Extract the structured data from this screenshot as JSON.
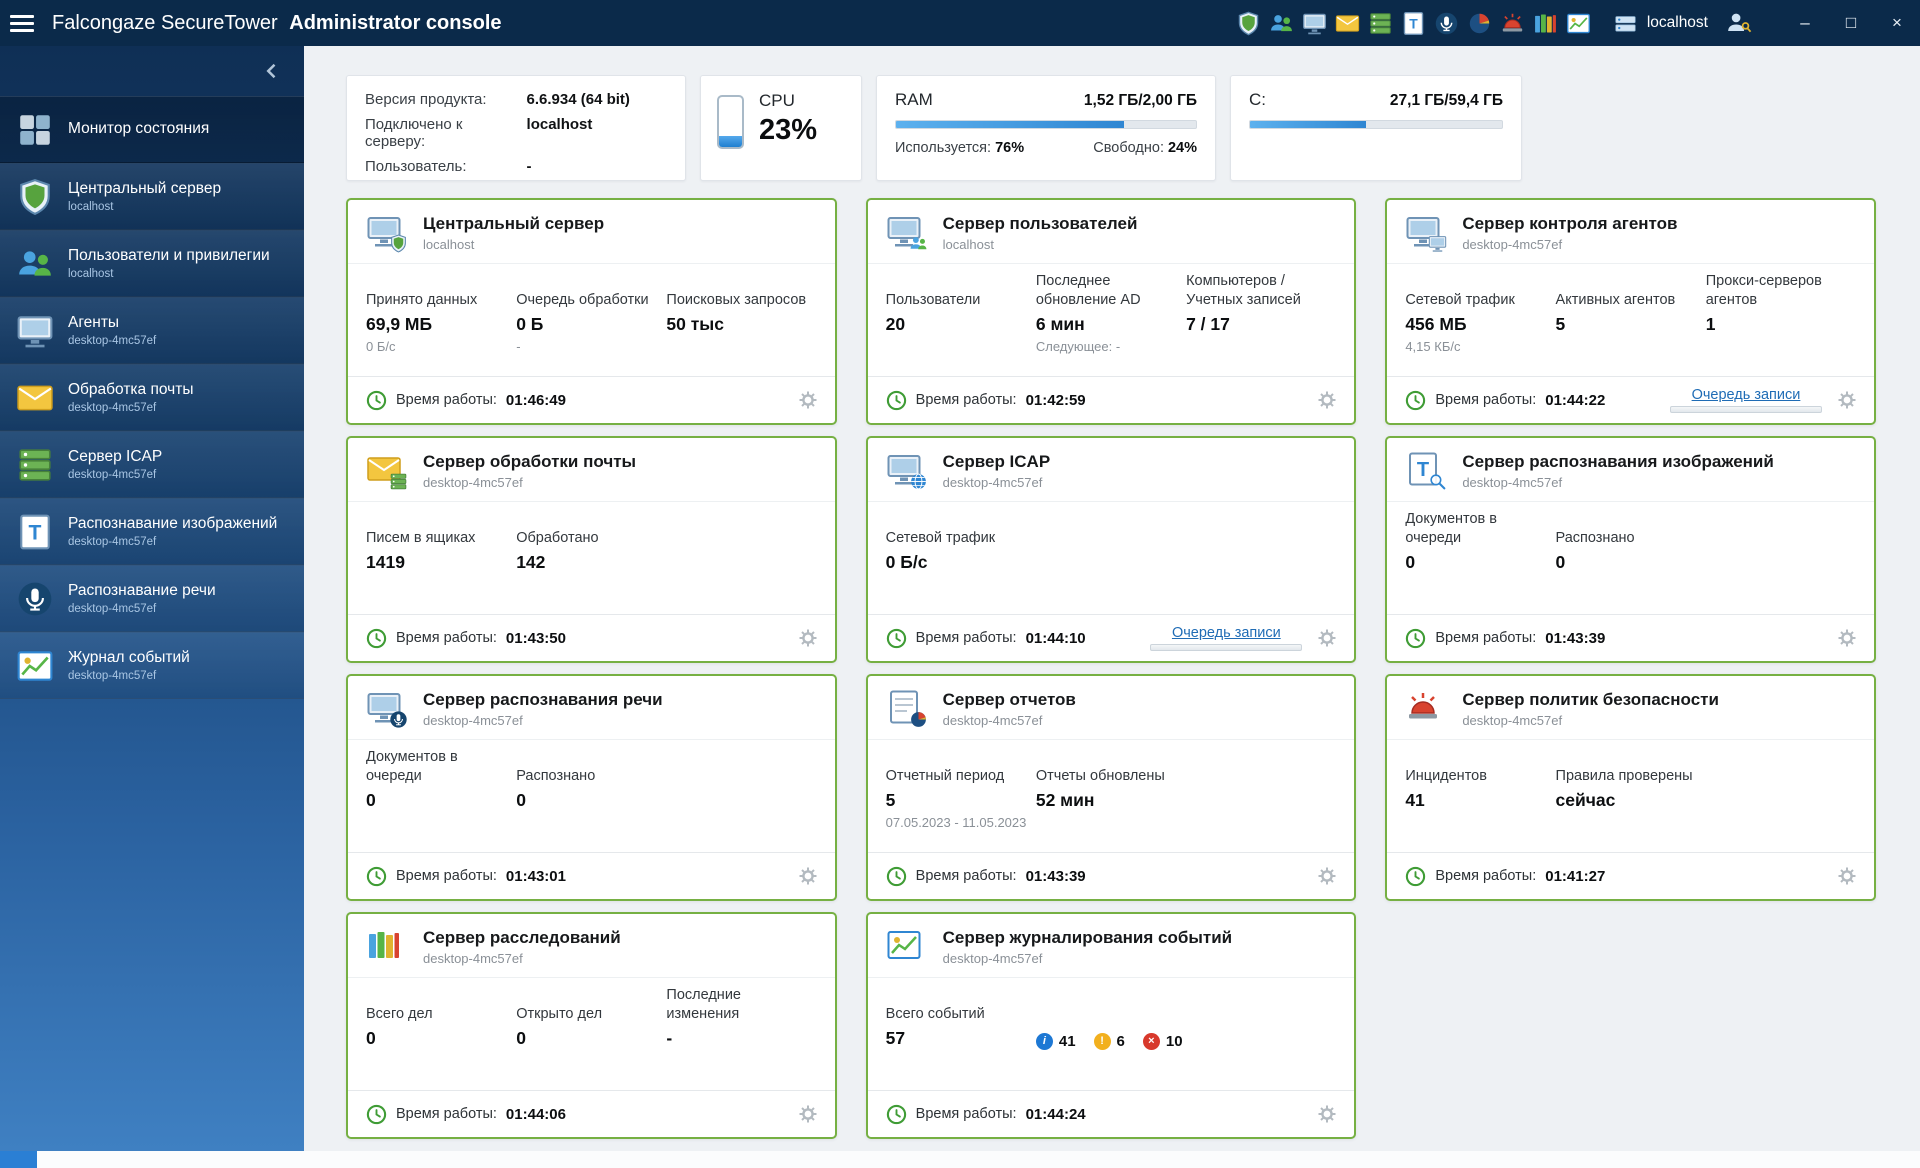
{
  "colors": {
    "titlebar_navy": "#0b2a4a",
    "card_border_green": "#76b043",
    "link_blue": "#1f6cb5",
    "progress_blue": "#2f86d2"
  },
  "titlebar": {
    "title_brand": "Falcongaze SecureTower",
    "title_bold": "Administrator console",
    "server_label": "localhost",
    "toolbar_icons": [
      {
        "name": "toolbar-central-server-icon",
        "icon": "shield"
      },
      {
        "name": "toolbar-users-icon",
        "icon": "users"
      },
      {
        "name": "toolbar-agents-icon",
        "icon": "monitor"
      },
      {
        "name": "toolbar-mail-processing-icon",
        "icon": "mail"
      },
      {
        "name": "toolbar-icap-icon",
        "icon": "server"
      },
      {
        "name": "toolbar-image-recognition-icon",
        "icon": "tdoc"
      },
      {
        "name": "toolbar-speech-recognition-icon",
        "icon": "mic"
      },
      {
        "name": "toolbar-reports-icon",
        "icon": "pie"
      },
      {
        "name": "toolbar-security-policies-icon",
        "icon": "alarm"
      },
      {
        "name": "toolbar-investigations-icon",
        "icon": "books"
      },
      {
        "name": "toolbar-event-journal-icon",
        "icon": "imagechart"
      }
    ],
    "window": {
      "minimize": "–",
      "maximize": "□",
      "close": "×"
    }
  },
  "sidebar": {
    "collapse_icon": "chevron-left",
    "items": [
      {
        "id": "status-monitor",
        "label": "Монитор состояния",
        "sub": "",
        "icon": "dashboard",
        "active": true
      },
      {
        "id": "central-server",
        "label": "Центральный сервер",
        "sub": "localhost",
        "icon": "shield",
        "active": false
      },
      {
        "id": "users-privileges",
        "label": "Пользователи и привилегии",
        "sub": "localhost",
        "icon": "users",
        "active": false
      },
      {
        "id": "agents",
        "label": "Агенты",
        "sub": "desktop-4mc57ef",
        "icon": "monitor",
        "active": false
      },
      {
        "id": "mail-processing",
        "label": "Обработка почты",
        "sub": "desktop-4mc57ef",
        "icon": "mail",
        "active": false
      },
      {
        "id": "icap-server",
        "label": "Сервер ICAP",
        "sub": "desktop-4mc57ef",
        "icon": "server",
        "active": false
      },
      {
        "id": "image-recognition",
        "label": "Распознавание изображений",
        "sub": "desktop-4mc57ef",
        "icon": "tdoc",
        "active": false
      },
      {
        "id": "speech-recognition",
        "label": "Распознавание речи",
        "sub": "desktop-4mc57ef",
        "icon": "mic",
        "active": false
      },
      {
        "id": "event-journal",
        "label": "Журнал событий",
        "sub": "desktop-4mc57ef",
        "icon": "imagechart",
        "active": false
      }
    ]
  },
  "info": {
    "version": {
      "rows": [
        [
          "Версия продукта:",
          "6.6.934 (64 bit)"
        ],
        [
          "Подключено к серверу:",
          "localhost"
        ],
        [
          "Пользователь:",
          "-"
        ]
      ]
    },
    "cpu": {
      "label": "CPU",
      "value": "23%",
      "percent": 23
    },
    "ram": {
      "label": "RAM",
      "value": "1,52 ГБ/2,00 ГБ",
      "percent": 76,
      "used_label": "Используется:",
      "used": "76%",
      "free_label": "Свободно:",
      "free": "24%"
    },
    "disk": {
      "label": "C:",
      "value": "27,1 ГБ/59,4 ГБ",
      "percent": 46
    }
  },
  "uptime_label": "Время работы:",
  "queue_link_label": "Очередь записи",
  "cards": [
    {
      "id": "central-server",
      "title": "Центральный сервер",
      "host": "localhost",
      "icon_base": "monitor",
      "icon_badge": "shield",
      "stats": [
        {
          "label": "Принято данных",
          "value": "69,9 МБ",
          "sub": "0 Б/с"
        },
        {
          "label": "Очередь обработки",
          "value": "0 Б",
          "sub": "-"
        },
        {
          "label": "Поисковых запросов",
          "value": "50 тыс",
          "sub": ""
        }
      ],
      "uptime": "01:46:49",
      "queue_link": false
    },
    {
      "id": "users-server",
      "title": "Сервер пользователей",
      "host": "localhost",
      "icon_base": "monitor",
      "icon_badge": "users",
      "stats": [
        {
          "label": "Пользователи",
          "value": "20",
          "sub": ""
        },
        {
          "label": "Последнее обновление AD",
          "value": "6 мин",
          "sub": "Следующее: -"
        },
        {
          "label": "Компьютеров / Учетных записей",
          "value": "7 / 17",
          "sub": ""
        }
      ],
      "uptime": "01:42:59",
      "queue_link": false
    },
    {
      "id": "agents-control-server",
      "title": "Сервер контроля агентов",
      "host": "desktop-4mc57ef",
      "icon_base": "monitor",
      "icon_badge": "monitor",
      "stats": [
        {
          "label": "Сетевой трафик",
          "value": "456 МБ",
          "sub": "4,15 КБ/с"
        },
        {
          "label": "Активных агентов",
          "value": "5",
          "sub": ""
        },
        {
          "label": "Прокси-серверов агентов",
          "value": "1",
          "sub": ""
        }
      ],
      "uptime": "01:44:22",
      "queue_link": true
    },
    {
      "id": "mail-processing-server",
      "title": "Сервер обработки почты",
      "host": "desktop-4mc57ef",
      "icon_base": "mail",
      "icon_badge": "server",
      "stats": [
        {
          "label": "Писем в ящиках",
          "value": "1419",
          "sub": ""
        },
        {
          "label": "Обработано",
          "value": "142",
          "sub": ""
        }
      ],
      "uptime": "01:43:50",
      "queue_link": false
    },
    {
      "id": "icap-server",
      "title": "Сервер ICAP",
      "host": "desktop-4mc57ef",
      "icon_base": "monitor",
      "icon_badge": "globe",
      "stats": [
        {
          "label": "Сетевой трафик",
          "value": "0 Б/с",
          "sub": ""
        }
      ],
      "uptime": "01:44:10",
      "queue_link": true
    },
    {
      "id": "image-recognition-server",
      "title": "Сервер распознавания изображений",
      "host": "desktop-4mc57ef",
      "icon_base": "tdoc",
      "icon_badge": "magnifier",
      "stats": [
        {
          "label": "Документов в очереди",
          "value": "0",
          "sub": ""
        },
        {
          "label": "Распознано",
          "value": "0",
          "sub": ""
        }
      ],
      "uptime": "01:43:39",
      "queue_link": false
    },
    {
      "id": "speech-recognition-server",
      "title": "Сервер распознавания речи",
      "host": "desktop-4mc57ef",
      "icon_base": "monitor",
      "icon_badge": "mic",
      "stats": [
        {
          "label": "Документов в очереди",
          "value": "0",
          "sub": ""
        },
        {
          "label": "Распознано",
          "value": "0",
          "sub": ""
        }
      ],
      "uptime": "01:43:01",
      "queue_link": false
    },
    {
      "id": "reports-server",
      "title": "Сервер отчетов",
      "host": "desktop-4mc57ef",
      "icon_base": "doc",
      "icon_badge": "pie",
      "stats": [
        {
          "label": "Отчетный период",
          "value": "5",
          "sub": "07.05.2023 - 11.05.2023"
        },
        {
          "label": "Отчеты обновлены",
          "value": "52 мин",
          "sub": ""
        }
      ],
      "uptime": "01:43:39",
      "queue_link": false
    },
    {
      "id": "security-policies-server",
      "title": "Сервер политик безопасности",
      "host": "desktop-4mc57ef",
      "icon_base": "alarm",
      "icon_badge": "",
      "stats": [
        {
          "label": "Инцидентов",
          "value": "41",
          "sub": ""
        },
        {
          "label": "Правила проверены",
          "value": "сейчас",
          "sub": ""
        }
      ],
      "uptime": "01:41:27",
      "queue_link": false
    },
    {
      "id": "investigations-server",
      "title": "Сервер расследований",
      "host": "desktop-4mc57ef",
      "icon_base": "books",
      "icon_badge": "",
      "stats": [
        {
          "label": "Всего дел",
          "value": "0",
          "sub": ""
        },
        {
          "label": "Открыто дел",
          "value": "0",
          "sub": ""
        },
        {
          "label": "Последние изменения",
          "value": "-",
          "sub": ""
        }
      ],
      "uptime": "01:44:06",
      "queue_link": false
    },
    {
      "id": "event-journal-server",
      "title": "Сервер журналирования событий",
      "host": "desktop-4mc57ef",
      "icon_base": "imagechart",
      "icon_badge": "",
      "stats": [
        {
          "label": "Всего событий",
          "value": "57",
          "sub": ""
        }
      ],
      "badges": [
        {
          "type": "info",
          "count": "41"
        },
        {
          "type": "warning",
          "count": "6"
        },
        {
          "type": "error",
          "count": "10"
        }
      ],
      "uptime": "01:44:24",
      "queue_link": false
    }
  ]
}
